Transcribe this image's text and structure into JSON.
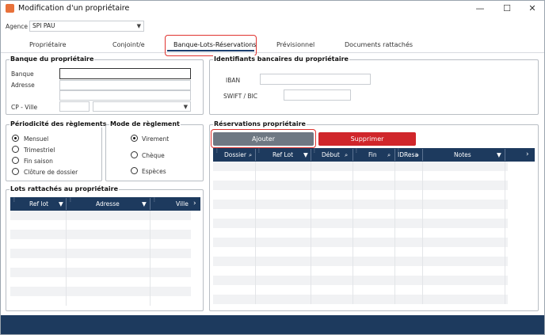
{
  "window": {
    "title": "Modification d'un propriétaire",
    "min": "—",
    "max": "☐",
    "close": "✕"
  },
  "agence": {
    "label": "Agence",
    "value": "SPI PAU"
  },
  "tabs": [
    {
      "label": "Propriétaire"
    },
    {
      "label": "Conjoint/e"
    },
    {
      "label": "Banque-Lots-Réservations"
    },
    {
      "label": "Prévisionnel"
    },
    {
      "label": "Documents rattachés"
    }
  ],
  "banque": {
    "title": "Banque du propriétaire",
    "banque_label": "Banque",
    "adresse_label": "Adresse",
    "cp_label": "CP - Ville",
    "banque_value": "",
    "adresse_value": ""
  },
  "identifiants": {
    "title": "Identifiants bancaires du propriétaire",
    "iban_label": "IBAN",
    "swift_label": "SWIFT / BIC"
  },
  "periodicite": {
    "title": "Périodicité des règlements",
    "options": [
      "Mensuel",
      "Trimestriel",
      "Fin saison",
      "Clôture de dossier"
    ],
    "selected": "Mensuel"
  },
  "mode": {
    "title": "Mode de règlement",
    "options": [
      "Virement",
      "Chèque",
      "Espèces"
    ],
    "selected": "Virement"
  },
  "reservations": {
    "title": "Réservations propriétaire",
    "add_label": "Ajouter",
    "delete_label": "Supprimer",
    "columns": [
      "Dossier",
      "Ref Lot",
      "Début",
      "Fin",
      "IDResa",
      "Notes"
    ],
    "scroll_right": "›"
  },
  "lots": {
    "title": "Lots rattachés au propriétaire",
    "columns": [
      "Ref lot",
      "Adresse",
      "Ville"
    ],
    "scroll_right": "›"
  },
  "colors": {
    "accent": "#1d3a5e",
    "delete": "#d0262b",
    "highlight": "#e0332f",
    "add": "#6f7883"
  }
}
